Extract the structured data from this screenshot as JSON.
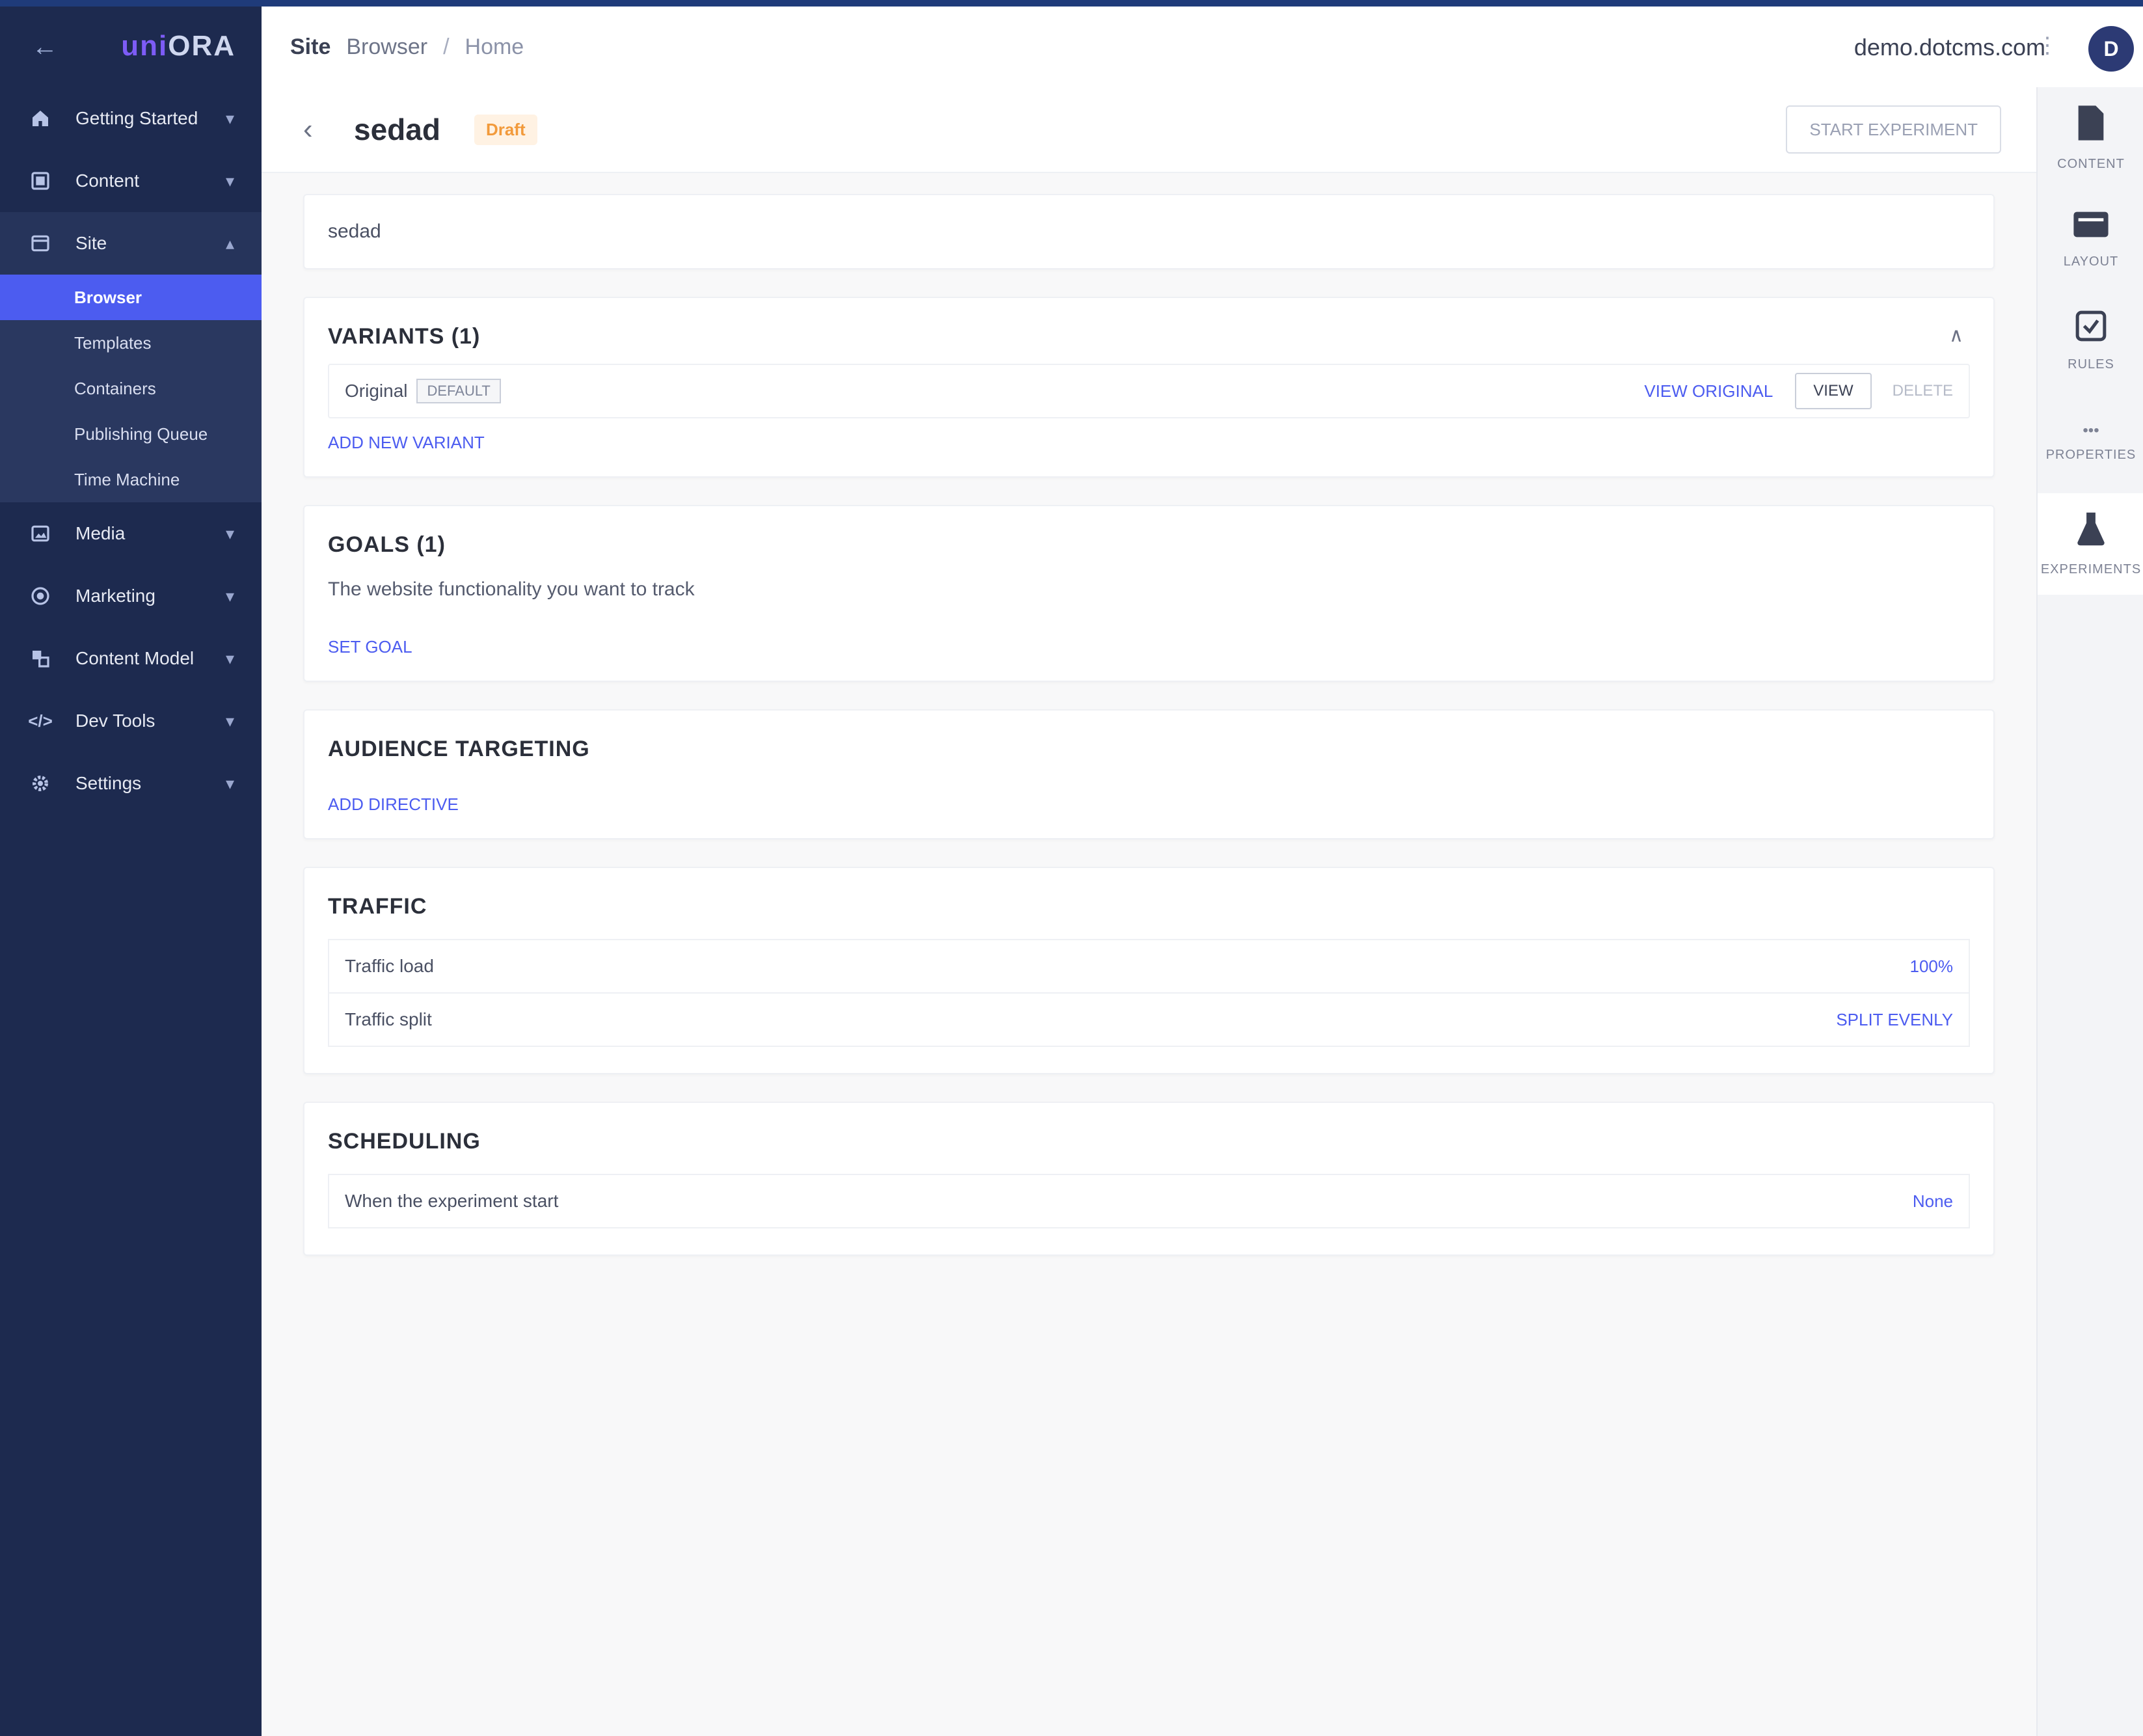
{
  "sidebar": {
    "logo_left": "uni",
    "logo_right": "ORA",
    "nav": [
      {
        "label": "Getting Started",
        "icon": "home-icon"
      },
      {
        "label": "Content",
        "icon": "content-icon"
      },
      {
        "label": "Site",
        "icon": "site-icon",
        "open": true,
        "children": [
          "Browser",
          "Templates",
          "Containers",
          "Publishing Queue",
          "Time Machine"
        ],
        "active_child": "Browser"
      },
      {
        "label": "Media",
        "icon": "media-icon"
      },
      {
        "label": "Marketing",
        "icon": "marketing-icon"
      },
      {
        "label": "Content Model",
        "icon": "content-model-icon"
      },
      {
        "label": "Dev Tools",
        "icon": "dev-tools-icon"
      },
      {
        "label": "Settings",
        "icon": "settings-icon"
      }
    ]
  },
  "header": {
    "crumb_root": "Site",
    "crumb_section": "Browser",
    "crumb_page": "Home",
    "domain": "demo.dotcms.com",
    "avatar_initial": "D"
  },
  "page": {
    "title": "sedad",
    "status": "Draft",
    "action_label": "START EXPERIMENT"
  },
  "rail": [
    {
      "label": "CONTENT",
      "icon": "document-icon"
    },
    {
      "label": "LAYOUT",
      "icon": "layout-icon"
    },
    {
      "label": "RULES",
      "icon": "rules-icon"
    },
    {
      "label": "PROPERTIES",
      "icon": "properties-icon"
    },
    {
      "label": "EXPERIMENTS",
      "icon": "experiments-icon",
      "active": true
    }
  ],
  "experiment": {
    "name": "sedad",
    "variants": {
      "heading": "VARIANTS (1)",
      "original_label": "Original",
      "original_tag": "DEFAULT",
      "view_link": "VIEW ORIGINAL",
      "edit_label": "VIEW",
      "delete_label": "DELETE",
      "add_label": "ADD NEW VARIANT"
    },
    "goals": {
      "heading": "GOALS (1)",
      "description": "The website functionality you want to track",
      "action": "SET GOAL"
    },
    "audience": {
      "heading": "AUDIENCE TARGETING",
      "action": "ADD DIRECTIVE"
    },
    "traffic": {
      "heading": "TRAFFIC",
      "rows": [
        {
          "label": "Traffic load",
          "value": "100%"
        },
        {
          "label": "Traffic split",
          "value": "SPLIT EVENLY"
        }
      ]
    },
    "scheduling": {
      "heading": "SCHEDULING",
      "row_label": "When the experiment start",
      "row_value": "None"
    }
  },
  "colors": {
    "sidebar_bg": "#1d2a4f",
    "accent": "#4c5cf0",
    "draft_badge": "#f29a3b"
  }
}
